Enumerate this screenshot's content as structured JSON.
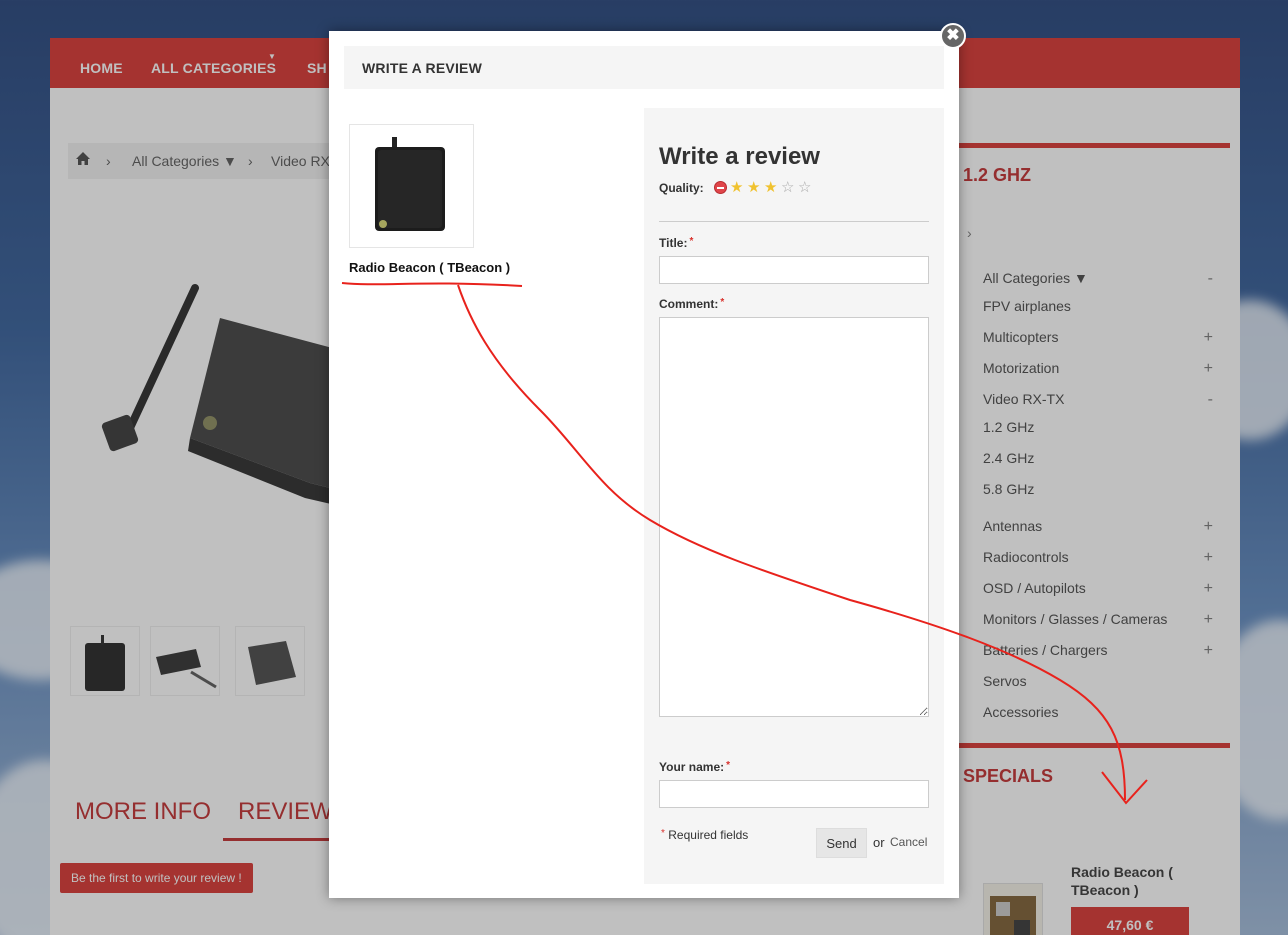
{
  "nav": {
    "home": "HOME",
    "all_categories": "ALL CATEGORIES",
    "third_partial": "SH"
  },
  "breadcrumb": {
    "all_categories": "All Categories ▼",
    "video_partial": "Video RX"
  },
  "tabs": {
    "more_info": "MORE INFO",
    "reviews": "REVIEWS"
  },
  "first_review_button": "Be the first to write your review !",
  "sidebar": {
    "category_title": "1.2 GHZ",
    "categories": [
      {
        "label": "All Categories ▼",
        "sign": "-"
      },
      {
        "label": "FPV airplanes",
        "sign": ""
      },
      {
        "label": "Multicopters",
        "sign": "+"
      },
      {
        "label": "Motorization",
        "sign": "+"
      },
      {
        "label": "Video RX-TX",
        "sign": "-"
      },
      {
        "label": "1.2 GHz",
        "sign": ""
      },
      {
        "label": "2.4 GHz",
        "sign": ""
      },
      {
        "label": "5.8 GHz",
        "sign": ""
      },
      {
        "label": "Antennas",
        "sign": "+"
      },
      {
        "label": "Radiocontrols",
        "sign": "+"
      },
      {
        "label": "OSD / Autopilots",
        "sign": "+"
      },
      {
        "label": "Monitors / Glasses / Cameras",
        "sign": "+"
      },
      {
        "label": "Batteries / Chargers",
        "sign": "+"
      },
      {
        "label": "Servos",
        "sign": ""
      },
      {
        "label": "Accessories",
        "sign": ""
      }
    ],
    "specials_title": "SPECIALS",
    "special_product_name": "Radio Beacon ( TBeacon )",
    "special_price": "47,60 €"
  },
  "modal": {
    "header_title": "WRITE A REVIEW",
    "close_glyph": "✖",
    "product_name": "Radio Beacon ( TBeacon )",
    "form_title": "Write a review",
    "quality_label": "Quality:",
    "rating": {
      "value": 3,
      "max": 5
    },
    "title_label": "Title:",
    "comment_label": "Comment:",
    "name_label": "Your name:",
    "required_asterisk": "*",
    "required_note": "Required fields",
    "send_label": "Send",
    "or_text": "or",
    "cancel_label": "Cancel"
  },
  "colors": {
    "brand_red": "#d8302b",
    "annotation_red": "#e8221c",
    "star_on": "#f0c22f"
  }
}
